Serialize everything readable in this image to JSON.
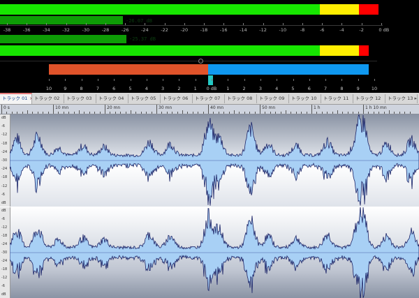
{
  "meters": {
    "scale_labels": [
      "-38",
      "-36",
      "-34",
      "-32",
      "-30",
      "-28",
      "-26",
      "-24",
      "-22",
      "-20",
      "-18",
      "-16",
      "-14",
      "-12",
      "-10",
      "-8",
      "-6",
      "-4",
      "-2",
      "0 dB"
    ],
    "left_peak_readout": "-26.07 dB",
    "right_peak_readout": "-25.37 dB",
    "colors": {
      "green": "#17e600",
      "yellow": "#ffee00",
      "red": "#ff0000",
      "hold": "#0e9c06"
    }
  },
  "correlation": {
    "scale_labels": [
      "10",
      "9",
      "8",
      "7",
      "6",
      "5",
      "4",
      "3",
      "2",
      "1",
      "0 dB",
      "1",
      "2",
      "3",
      "4",
      "5",
      "6",
      "7",
      "8",
      "9",
      "10"
    ],
    "left_color": "#e0532a",
    "right_color": "#0f98f0",
    "marker_color": "#23c9c4"
  },
  "tabs": [
    {
      "label": "トラック 01",
      "active": true
    },
    {
      "label": "トラック 02"
    },
    {
      "label": "トラック 03"
    },
    {
      "label": "トラック 04"
    },
    {
      "label": "トラック 05"
    },
    {
      "label": "トラック 06"
    },
    {
      "label": "トラック 07"
    },
    {
      "label": "トラック 08"
    },
    {
      "label": "トラック 09"
    },
    {
      "label": "トラック 10"
    },
    {
      "label": "トラック 11"
    },
    {
      "label": "トラック 12"
    },
    {
      "label": "トラック 13"
    }
  ],
  "tab_close_glyph": "×",
  "tabs_scroll_glyph": "▸",
  "ruler": {
    "labels": [
      "0 s",
      "10 mn",
      "20 mn",
      "30 mn",
      "40 mn",
      "50 mn",
      "1 h",
      "1 h 10 mn"
    ]
  },
  "amplitude_labels": [
    "dB",
    "-6",
    "-12",
    "-18",
    "-24",
    "-30",
    "-24",
    "-18",
    "-12",
    "-6",
    "dB"
  ],
  "waveform": {
    "fill": "#a8d0f5",
    "stroke": "#1a2266"
  }
}
